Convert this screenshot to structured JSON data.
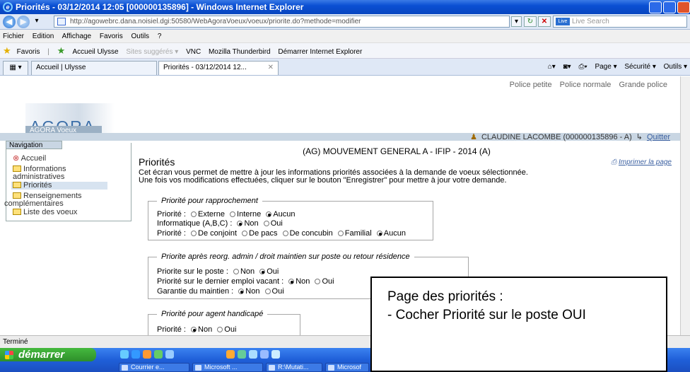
{
  "window": {
    "title": "Priorités - 03/12/2014 12:05 [000000135896] - Windows Internet Explorer"
  },
  "address": {
    "url": "http://agowebrc.dana.noisiel.dgi:50580/WebAgoraVoeux/voeux/priorite.do?methode=modifier",
    "search_placeholder": "Live Search",
    "live_label": "Live"
  },
  "menu": [
    "Fichier",
    "Edition",
    "Affichage",
    "Favoris",
    "Outils",
    "?"
  ],
  "favorites": {
    "label": "Favoris",
    "items": [
      "Accueil Ulysse",
      "Sites suggérés ▾",
      "VNC",
      "Mozilla Thunderbird",
      "Démarrer Internet Explorer"
    ]
  },
  "tabs": [
    {
      "label": "Accueil | Ulysse"
    },
    {
      "label": "Priorités - 03/12/2014 12..."
    }
  ],
  "commands": [
    "Page ▾",
    "Sécurité ▾",
    "Outils ▾"
  ],
  "page": {
    "font_links": [
      "Police petite",
      "Police normale",
      "Grande police"
    ],
    "logo": "AGORA",
    "logo_sub": "AGORA Voeux",
    "user": "CLAUDINE LACOMBE (000000135896 - A)",
    "quit": "Quitter",
    "nav_header": "Navigation",
    "nav": [
      "Accueil",
      "Informations",
      "administratives",
      "Priorités",
      "Renseignements",
      "complémentaires",
      "Liste des voeux"
    ],
    "context_title": "(AG) MOUVEMENT GENERAL A - IFIP - 2014 (A)",
    "heading": "Priorités",
    "print": "Imprimer la page",
    "intro1": "Cet écran vous permet de mettre à jour les informations priorités associées à la demande de voeux sélectionnée.",
    "intro2": "Une fois vos modifications effectuées, cliquer sur le bouton \"Enregistrer\" pour mettre à jour votre demande.",
    "sec1": {
      "legend": "Priorité pour rapprochement",
      "r1": {
        "label": "Priorité :",
        "opts": [
          "Externe",
          "Interne",
          "Aucun"
        ]
      },
      "r2": {
        "label": "Informatique (A,B,C) :",
        "opts": [
          "Non",
          "Oui"
        ]
      },
      "r3": {
        "label": "Priorité :",
        "opts": [
          "De conjoint",
          "De pacs",
          "De concubin",
          "Familial",
          "Aucun"
        ]
      }
    },
    "sec2": {
      "legend": "Priorite après reorg. admin / droit maintien sur poste ou retour résidence",
      "r1": {
        "label": "Priorite sur le poste :",
        "opts": [
          "Non",
          "Oui"
        ]
      },
      "r2": {
        "label": "Priorité sur le dernier emploi vacant :",
        "opts": [
          "Non",
          "Oui"
        ]
      },
      "r3": {
        "label": "Garantie du maintien :",
        "opts": [
          "Non",
          "Oui"
        ]
      }
    },
    "sec3": {
      "legend": "Priorité pour agent handicapé",
      "r1": {
        "label": "Priorité :",
        "opts": [
          "Non",
          "Oui"
        ]
      }
    }
  },
  "callout": {
    "line1": "Page des priorités :",
    "line2": "- Cocher Priorité sur le poste OUI"
  },
  "status": "Terminé",
  "taskbar": {
    "start": "démarrer",
    "tasks": [
      "Courrier e...",
      "Microsoft ...",
      "R:\\Mutati...",
      "Microsof"
    ]
  }
}
